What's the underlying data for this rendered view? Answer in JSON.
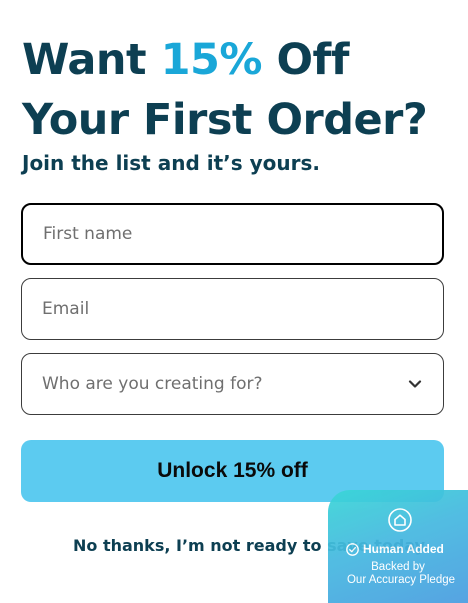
{
  "headline": {
    "line1_pre": "Want ",
    "line1_accent": "15%",
    "line1_post": " Off",
    "line2": "Your First Order?"
  },
  "subhead": "Join the list and it’s yours.",
  "form": {
    "first_name_placeholder": "First name",
    "first_name_value": "",
    "email_placeholder": "Email",
    "email_value": "",
    "audience_placeholder": "Who are you creating for?",
    "submit_label": "Unlock 15% off"
  },
  "decline_label": "No thanks, I’m not ready to save today.",
  "badge": {
    "title": "Human Added",
    "line1": "Backed by",
    "line2": "Our Accuracy Pledge"
  },
  "colors": {
    "heading": "#0d3f52",
    "accent": "#1aa7d8",
    "button": "#5ccbf0"
  }
}
